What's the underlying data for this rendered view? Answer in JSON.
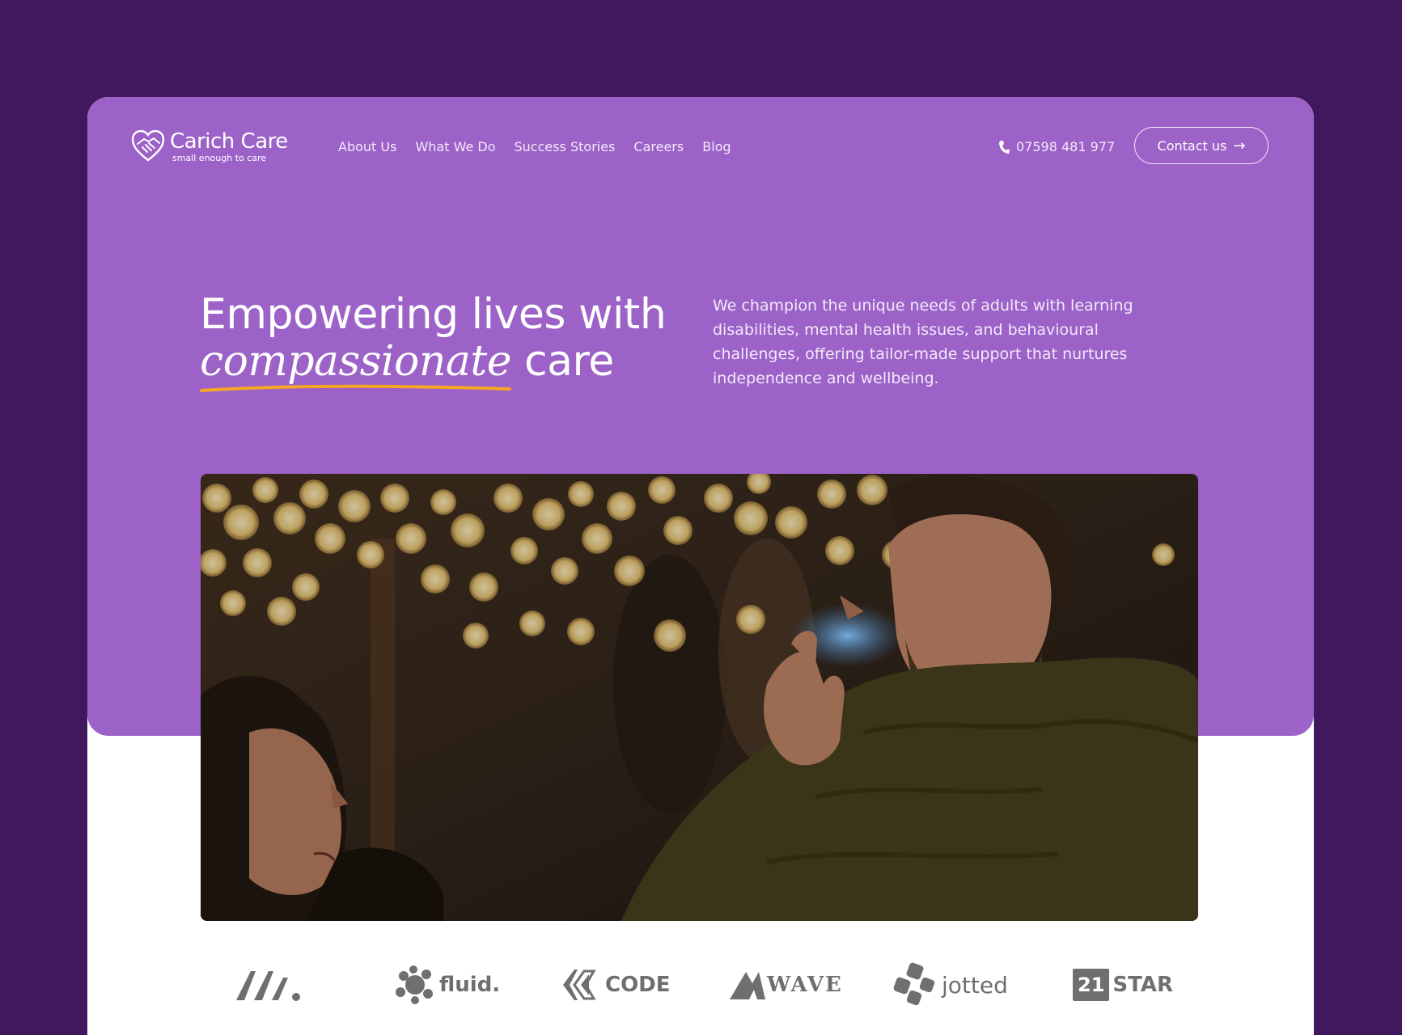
{
  "brand": {
    "name": "Carich Care",
    "tagline": "small enough to care"
  },
  "nav": {
    "items": [
      {
        "label": "About Us"
      },
      {
        "label": "What We Do"
      },
      {
        "label": "Success Stories"
      },
      {
        "label": "Careers"
      },
      {
        "label": "Blog"
      }
    ],
    "phone": "07598 481 977",
    "contact_label": "Contact us"
  },
  "hero": {
    "headline_line1": "Empowering lives with",
    "headline_accent": "compassionate",
    "headline_end": " care",
    "intro": "We champion the unique needs of adults with learning disabilities, mental health issues, and behavioural challenges, offering tailor-made support that nurtures independence and wellbeing."
  },
  "partners": [
    {
      "name": "m-logo",
      "label": ""
    },
    {
      "name": "fluid-logo",
      "label": "fluid."
    },
    {
      "name": "code-logo",
      "label": "CODE"
    },
    {
      "name": "wave-logo",
      "label": "WAVE"
    },
    {
      "name": "jotted-logo",
      "label": "jotted"
    },
    {
      "name": "21star-logo",
      "label": "STAR",
      "badge": "21"
    }
  ],
  "colors": {
    "background": "#41185e",
    "hero": "#9c62c8",
    "accent_underline": "#f5a623",
    "logo_grey": "#6f6f6f"
  }
}
